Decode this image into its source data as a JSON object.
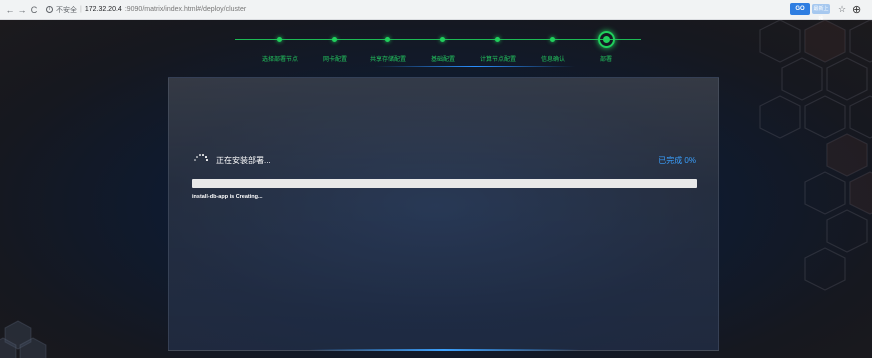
{
  "browser": {
    "back": "←",
    "forward": "→",
    "reload": "C",
    "security_label": "不安全",
    "url_host": "172.32.20.4",
    "url_path": ":9090/matrix/index.html#/deploy/cluster",
    "ext_badge": "GO",
    "ext_label": "最新上映",
    "star": "☆",
    "account": "⊕"
  },
  "stepper": {
    "steps": [
      {
        "label": "选择部署节点"
      },
      {
        "label": "网卡配置"
      },
      {
        "label": "共享存储配置"
      },
      {
        "label": "基础配置"
      },
      {
        "label": "计算节点配置"
      },
      {
        "label": "信息确认"
      },
      {
        "label": "部署"
      }
    ],
    "active_index": 6,
    "color": "#20d05c"
  },
  "install": {
    "status_text": "正在安装部署...",
    "progress_text": "已完成 0%",
    "progress_value": 0,
    "log_line": "install-db-app is Creating...",
    "accent_color": "#3aa0ff"
  }
}
